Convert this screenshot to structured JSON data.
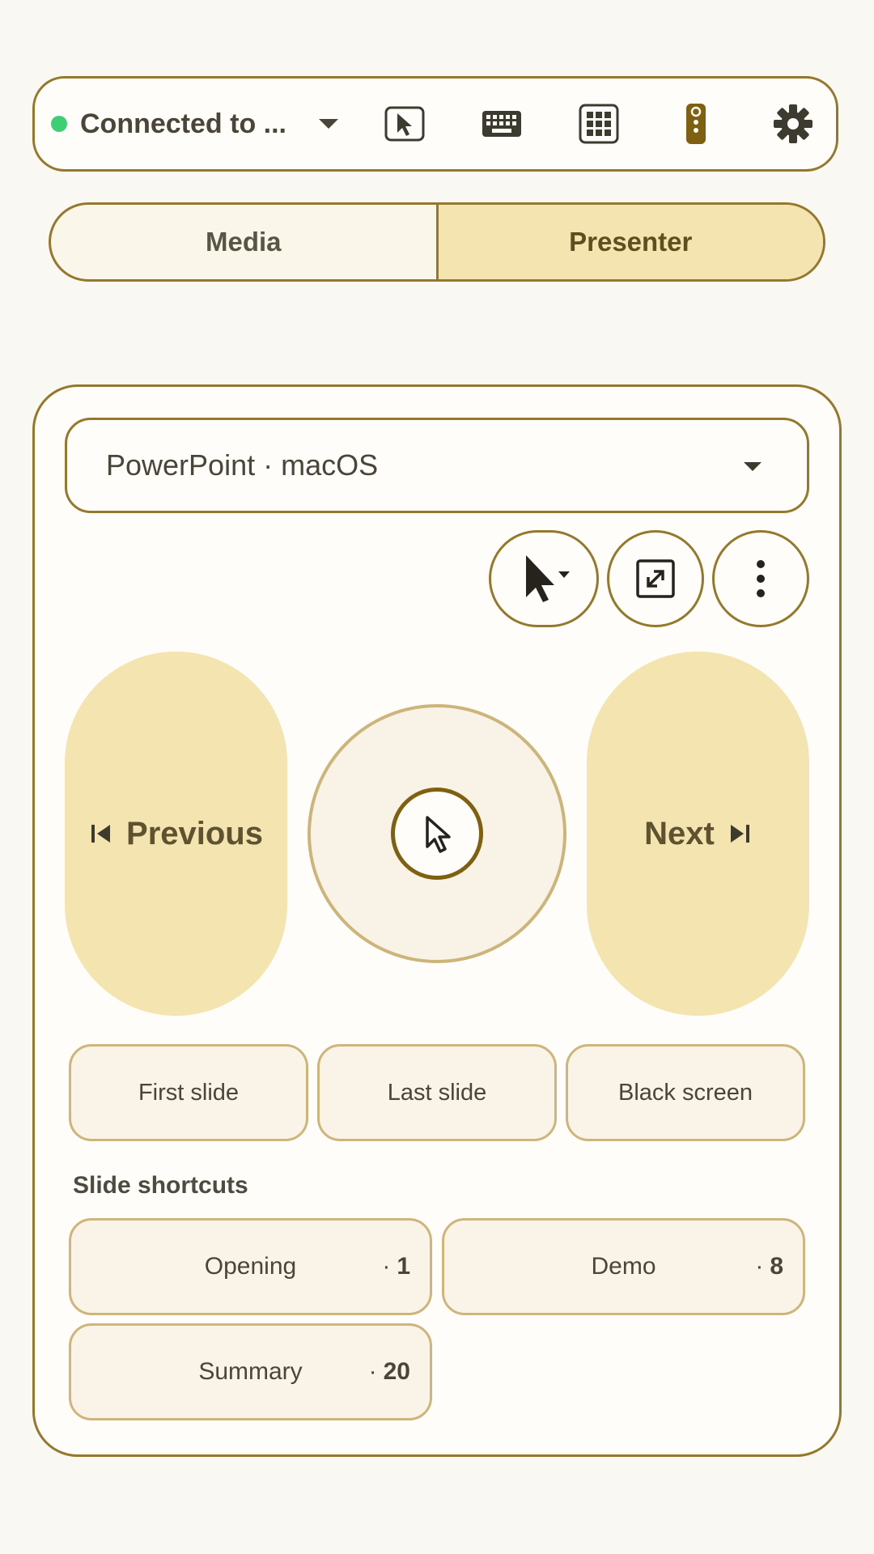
{
  "topbar": {
    "connection_label": "Connected to ...",
    "connection_status_color": "#3ecf74",
    "icons": [
      "pointer-icon",
      "keyboard-icon",
      "numpad-icon",
      "remote-icon",
      "gear-icon"
    ],
    "active_icon": "remote-icon"
  },
  "tabs": [
    {
      "label": "Media",
      "active": false
    },
    {
      "label": "Presenter",
      "active": true
    }
  ],
  "presenter": {
    "app_select_value": "PowerPoint · macOS",
    "previous_label": "Previous",
    "next_label": "Next",
    "actions": {
      "first_slide": "First slide",
      "last_slide": "Last slide",
      "black_screen": "Black screen"
    },
    "shortcuts_title": "Slide shortcuts",
    "shortcuts": [
      {
        "name": "Opening",
        "slide": "1"
      },
      {
        "name": "Demo",
        "slide": "8"
      },
      {
        "name": "Summary",
        "slide": "20"
      }
    ]
  },
  "colors": {
    "accent": "#96782c",
    "button_fill": "#f3e4b0",
    "background": "#faf8f2"
  }
}
